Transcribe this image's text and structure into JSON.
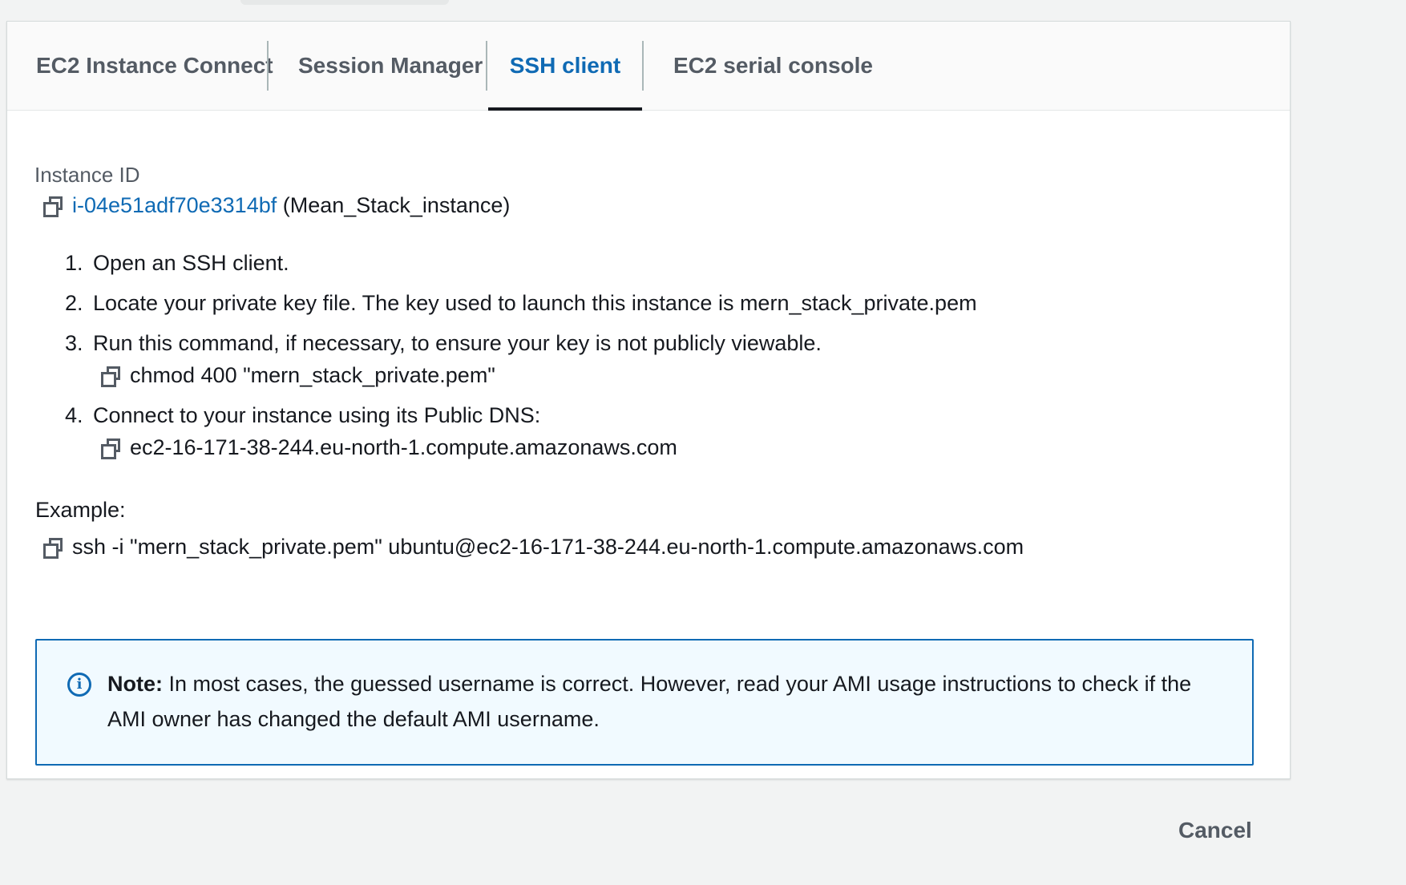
{
  "tabs": [
    {
      "label": "EC2 Instance Connect"
    },
    {
      "label": "Session Manager"
    },
    {
      "label": "SSH client",
      "active": true
    },
    {
      "label": "EC2 serial console"
    }
  ],
  "instance": {
    "label": "Instance ID",
    "id": "i-04e51adf70e3314bf",
    "name": "(Mean_Stack_instance)"
  },
  "steps": [
    {
      "num": "1.",
      "text": "Open an SSH client."
    },
    {
      "num": "2.",
      "text": "Locate your private key file. The key used to launch this instance is mern_stack_private.pem"
    },
    {
      "num": "3.",
      "text": "Run this command, if necessary, to ensure your key is not publicly viewable.",
      "command": "chmod 400 \"mern_stack_private.pem\""
    },
    {
      "num": "4.",
      "text": "Connect to your instance using its Public DNS:",
      "command": "ec2-16-171-38-244.eu-north-1.compute.amazonaws.com"
    }
  ],
  "example": {
    "label": "Example:",
    "command": "ssh -i \"mern_stack_private.pem\" ubuntu@ec2-16-171-38-244.eu-north-1.compute.amazonaws.com"
  },
  "note": {
    "icon": "info-icon",
    "title": "Note:",
    "text": " In most cases, the guessed username is correct. However, read your AMI usage instructions to check if the AMI owner has changed the default AMI username."
  },
  "footer": {
    "cancel_label": "Cancel"
  },
  "colors": {
    "link": "#0f6ab4",
    "active_tab_underline": "#16191f",
    "note_bg": "#f1faff",
    "page_bg": "#f2f3f3"
  }
}
